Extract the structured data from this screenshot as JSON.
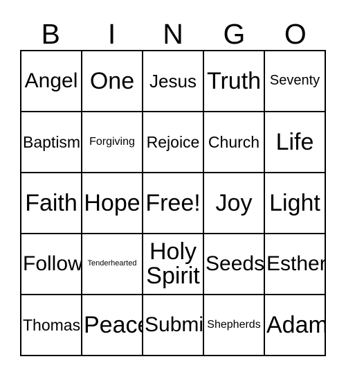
{
  "card": {
    "header_letters": [
      "B",
      "I",
      "N",
      "G",
      "O"
    ],
    "grid": {
      "rows": 5,
      "columns": 5,
      "border_color": "#000000",
      "background_color": "#ffffff",
      "text_color": "#000000"
    },
    "cells": [
      [
        {
          "text": "Angel",
          "size": "fs-xl"
        },
        {
          "text": "One",
          "size": "fs-xxl"
        },
        {
          "text": "Jesus",
          "size": "fs-l"
        },
        {
          "text": "Truth",
          "size": "fs-xxl"
        },
        {
          "text": "Seventy",
          "size": "fs-s"
        }
      ],
      [
        {
          "text": "Baptism",
          "size": "fs-m"
        },
        {
          "text": "Forgiving",
          "size": "fs-xs"
        },
        {
          "text": "Rejoice",
          "size": "fs-m"
        },
        {
          "text": "Church",
          "size": "fs-m"
        },
        {
          "text": "Life",
          "size": "fs-xxl"
        }
      ],
      [
        {
          "text": "Faith",
          "size": "fs-xxl"
        },
        {
          "text": "Hope",
          "size": "fs-xxl"
        },
        {
          "text": "Free!",
          "size": "fs-xxl"
        },
        {
          "text": "Joy",
          "size": "fs-xxl"
        },
        {
          "text": "Light",
          "size": "fs-xxl"
        }
      ],
      [
        {
          "text": "Follow",
          "size": "fs-xl"
        },
        {
          "text": "Tenderhearted",
          "size": "fs-xxs"
        },
        {
          "text": "Holy Spirit",
          "size": "fs-xxl"
        },
        {
          "text": "Seeds",
          "size": "fs-xl"
        },
        {
          "text": "Esther",
          "size": "fs-xl"
        }
      ],
      [
        {
          "text": "Thomas",
          "size": "fs-m"
        },
        {
          "text": "Peace",
          "size": "fs-xxl"
        },
        {
          "text": "Submit",
          "size": "fs-xl"
        },
        {
          "text": "Shepherds",
          "size": "fs-xs"
        },
        {
          "text": "Adam",
          "size": "fs-xxl"
        }
      ]
    ]
  }
}
